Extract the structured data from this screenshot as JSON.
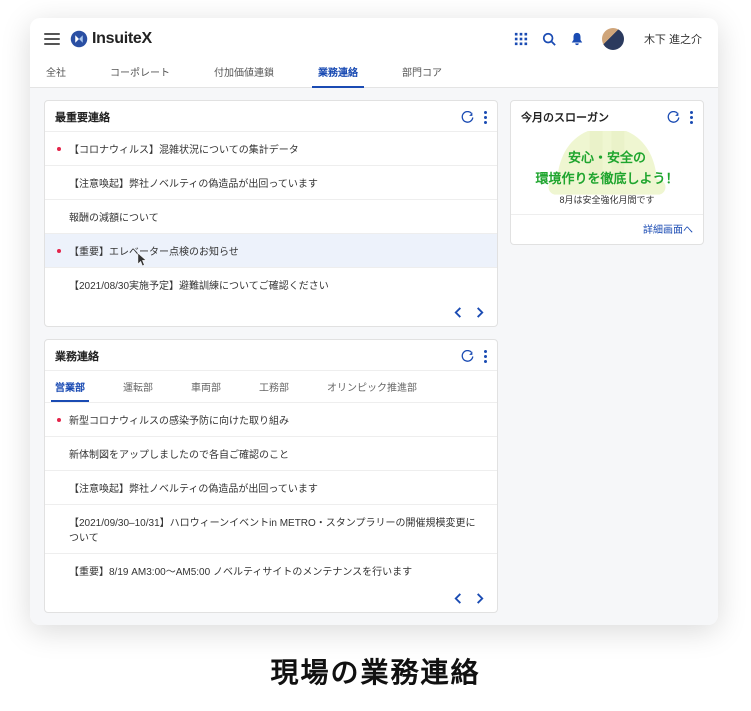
{
  "brand": {
    "name": "InsuiteX"
  },
  "user": {
    "name": "木下 進之介"
  },
  "main_tabs": [
    {
      "label": "全社",
      "active": false
    },
    {
      "label": "コーポレート",
      "active": false
    },
    {
      "label": "付加価値連鎖",
      "active": false
    },
    {
      "label": "業務連絡",
      "active": true
    },
    {
      "label": "部門コア",
      "active": false
    }
  ],
  "cards": {
    "important": {
      "title": "最重要連絡",
      "items": [
        {
          "text": "【コロナウィルス】混雑状況についての集計データ",
          "red": true,
          "hover": false
        },
        {
          "text": "【注意喚起】弊社ノベルティの偽造品が出回っています",
          "red": false,
          "hover": false
        },
        {
          "text": "報酬の減額について",
          "red": false,
          "hover": false
        },
        {
          "text": "【重要】エレベーター点検のお知らせ",
          "red": true,
          "hover": true
        },
        {
          "text": "【2021/08/30実施予定】避難訓練についてご確認ください",
          "red": false,
          "hover": false
        }
      ]
    },
    "slogan": {
      "title": "今月のスローガン",
      "line1": "安心・安全の",
      "line2": "環境作りを徹底しよう！",
      "sub": "8月は安全強化月間です",
      "link": "詳細画面へ"
    },
    "gyomu": {
      "title": "業務連絡",
      "tabs": [
        {
          "label": "営業部",
          "active": true
        },
        {
          "label": "運転部",
          "active": false
        },
        {
          "label": "車両部",
          "active": false
        },
        {
          "label": "工務部",
          "active": false
        },
        {
          "label": "オリンピック推進部",
          "active": false
        }
      ],
      "items": [
        {
          "text": "新型コロナウィルスの感染予防に向けた取り組み",
          "red": true
        },
        {
          "text": "新体制図をアップしましたので各自ご確認のこと",
          "red": false
        },
        {
          "text": "【注意喚起】弊社ノベルティの偽造品が出回っています",
          "red": false
        },
        {
          "text": "【2021/09/30–10/31】ハロウィーンイベントin METRO・スタンプラリーの開催規模変更について",
          "red": false
        },
        {
          "text": "【重要】8/19 AM3:00〜AM5:00 ノベルティサイトのメンテナンスを行います",
          "red": false
        }
      ]
    }
  },
  "caption": "現場の業務連絡"
}
